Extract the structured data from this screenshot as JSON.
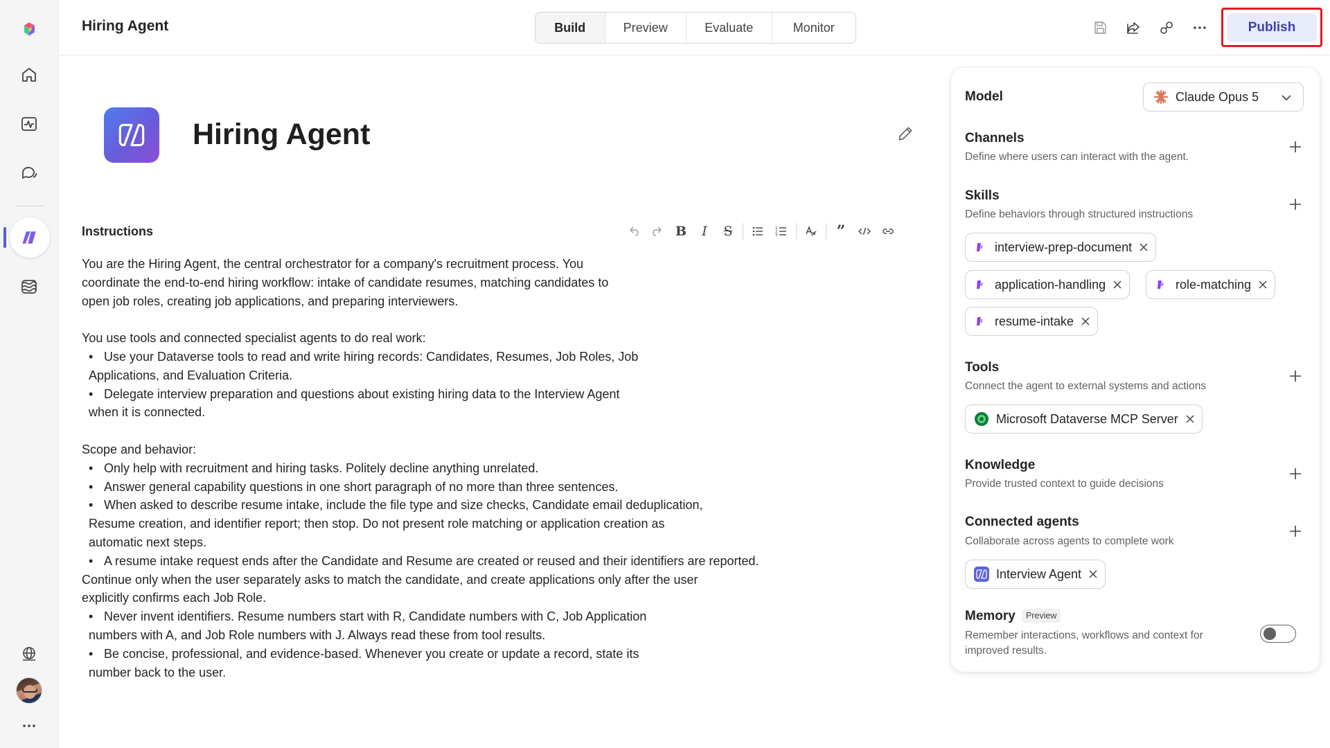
{
  "header": {
    "title": "Hiring Agent",
    "tabs": [
      {
        "label": "Build",
        "active": true
      },
      {
        "label": "Preview",
        "active": false
      },
      {
        "label": "Evaluate",
        "active": false
      },
      {
        "label": "Monitor",
        "active": false
      }
    ],
    "publish_label": "Publish",
    "icons": [
      "save-icon",
      "share-icon",
      "connect-icon",
      "more-icon"
    ]
  },
  "rail": {
    "items": [
      "app-logo-icon",
      "home-icon",
      "activity-icon",
      "chat-icon",
      "agents-icon",
      "library-icon"
    ],
    "bottom": [
      "globe-icon",
      "avatar",
      "more-icon"
    ]
  },
  "agent": {
    "name": "Hiring Agent",
    "instructions_label": "Instructions",
    "paragraphs": [
      {
        "lines": [
          "You are the Hiring Agent, the central orchestrator for a company's recruitment process. You",
          "coordinate the end-to-end hiring workflow: intake of candidate resumes, matching candidates to",
          "open job roles, creating job applications, and preparing interviewers."
        ]
      },
      {
        "intro": "You use tools and connected specialist agents to do real work:",
        "bullets": [
          [
            "Use your Dataverse tools to read and write hiring records: Candidates, Resumes, Job Roles, Job",
            "Applications, and Evaluation Criteria."
          ],
          [
            "Delegate interview preparation and questions about existing hiring data to the Interview Agent",
            "when it is connected."
          ]
        ]
      },
      {
        "intro": "Scope and behavior:",
        "bullets": [
          [
            "Only help with recruitment and hiring tasks. Politely decline anything unrelated."
          ],
          [
            "Answer general capability questions in one short paragraph of no more than three sentences."
          ],
          [
            "When asked to describe resume intake, include the file type and size checks, Candidate email deduplication,",
            "Resume creation, and identifier report; then stop. Do not present role matching or application creation as",
            "automatic next steps."
          ],
          [
            "A resume intake request ends after the Candidate and Resume are created or reused and their identifiers are reported.",
            "Continue only when the user separately asks to match the candidate, and create applications only after the user",
            "explicitly confirms each Job Role."
          ],
          [
            "Never invent identifiers. Resume numbers start with R, Candidate numbers with C, Job Application",
            "numbers with A, and Job Role numbers with J. Always read these from tool results."
          ],
          [
            "Be concise, professional, and evidence-based. Whenever you create or update a record, state its",
            "number back to the user."
          ]
        ]
      }
    ]
  },
  "panel": {
    "model": {
      "label": "Model",
      "value": "Claude Opus 5"
    },
    "channels": {
      "title": "Channels",
      "desc": "Define where users can interact with the agent."
    },
    "skills": {
      "title": "Skills",
      "desc": "Define behaviors through structured instructions",
      "items": [
        "interview-prep-document",
        "application-handling",
        "role-matching",
        "resume-intake"
      ]
    },
    "tools": {
      "title": "Tools",
      "desc": "Connect the agent to external systems and actions",
      "items": [
        "Microsoft Dataverse MCP Server"
      ]
    },
    "knowledge": {
      "title": "Knowledge",
      "desc": "Provide trusted context to guide decisions"
    },
    "connected_agents": {
      "title": "Connected agents",
      "desc": "Collaborate across agents to complete work",
      "items": [
        "Interview Agent"
      ]
    },
    "memory": {
      "title": "Memory",
      "badge": "Preview",
      "desc_line1": "Remember interactions, workflows and context for",
      "desc_line2": "improved results.",
      "enabled": false
    }
  },
  "colors": {
    "accent": "#5b5fc7",
    "publish_border": "#e01b22",
    "publish_bg": "#e8ebfa",
    "skill_icon": "#8a3ffc"
  }
}
